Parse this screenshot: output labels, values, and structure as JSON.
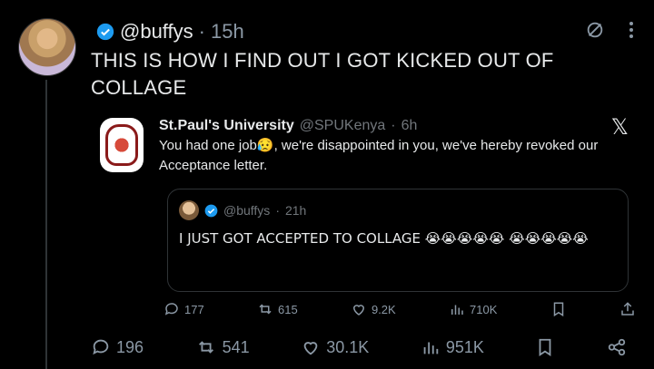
{
  "tweet": {
    "handle": "@buffys",
    "separator": "·",
    "time": "15h",
    "text": "THIS IS HOW I FIND OUT I GOT KICKED OUT OF COLLAGE"
  },
  "embedded": {
    "name": "St.Paul's University",
    "handle": "@SPUKenya",
    "separator": "·",
    "time": "6h",
    "text": "You had one job😥, we're disappointed in you, we've hereby revoked our Acceptance letter.",
    "quote": {
      "handle": "@buffys",
      "separator": "·",
      "time": "21h",
      "text": "I JUST GOT ACCEPTED TO COLLAGE 😭😭😭😭😭 😭😭😭😭😭"
    },
    "stats": {
      "replies": "177",
      "reposts": "615",
      "likes": "9.2K",
      "views": "710K"
    }
  },
  "stats": {
    "replies": "196",
    "reposts": "541",
    "likes": "30.1K",
    "views": "951K"
  },
  "icons": {
    "accent": "#1d9bf0"
  }
}
